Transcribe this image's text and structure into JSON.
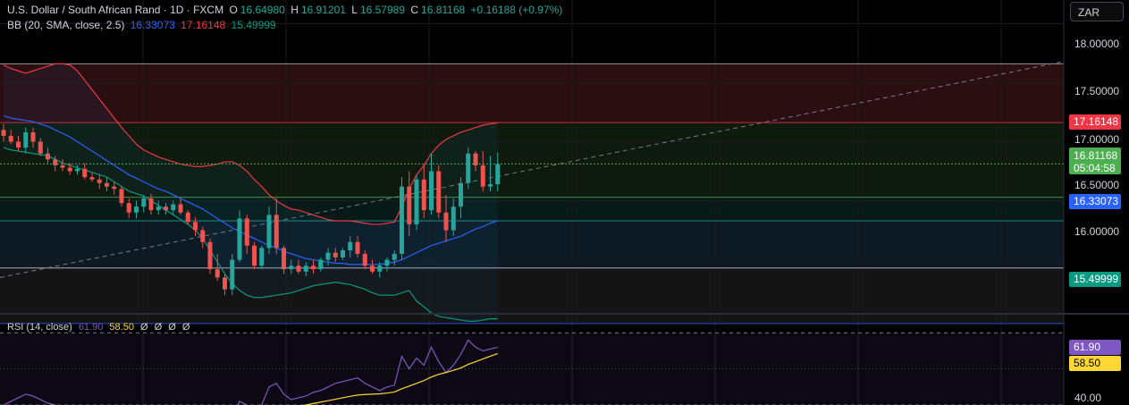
{
  "symbol": {
    "name": "U.S. Dollar / South African Rand · 1D · FXCM",
    "open_label": "O",
    "open": "16.64980",
    "high_label": "H",
    "high": "16.91201",
    "low_label": "L",
    "low": "16.57989",
    "close_label": "C",
    "close": "16.81168",
    "change": "+0.16188 (+0.97%)"
  },
  "bb": {
    "label": "BB (20, SMA, close, 2.5)",
    "basis": "16.33073",
    "upper": "17.16148",
    "lower": "15.49999"
  },
  "rsi": {
    "label": "RSI (14, close)",
    "value": "61.90",
    "ma": "58.50",
    "extra": [
      "Ø",
      "Ø",
      "Ø",
      "Ø"
    ]
  },
  "currency_button": "ZAR",
  "price_axis": {
    "ticks": [
      "18.00000",
      "17.50000",
      "17.00000",
      "16.50000",
      "16.00000"
    ],
    "countdown": "05:04:58"
  },
  "rsi_axis": {
    "ticks": [
      "40.00"
    ]
  },
  "colors": {
    "up": "#26a69a",
    "down": "#ef5350",
    "basis": "#2962ff",
    "upper": "#f23645",
    "lower": "#089981",
    "rsi": "#7e57c2",
    "rsi_ma": "#fdd835",
    "last": "#4caf50"
  },
  "chart_data": {
    "type": "candlestick",
    "last_price": 16.81168,
    "ylim": [
      15.55,
      18.2
    ],
    "candles": [
      [
        17.1,
        17.15,
        17.0,
        17.05
      ],
      [
        17.05,
        17.1,
        16.98,
        17.0
      ],
      [
        17.0,
        17.05,
        16.92,
        16.95
      ],
      [
        16.95,
        17.12,
        16.9,
        17.08
      ],
      [
        17.08,
        17.12,
        16.95,
        17.0
      ],
      [
        17.0,
        17.03,
        16.88,
        16.9
      ],
      [
        16.9,
        16.95,
        16.82,
        16.85
      ],
      [
        16.85,
        16.88,
        16.75,
        16.8
      ],
      [
        16.8,
        16.85,
        16.75,
        16.78
      ],
      [
        16.78,
        16.82,
        16.72,
        16.75
      ],
      [
        16.75,
        16.8,
        16.72,
        16.77
      ],
      [
        16.77,
        16.82,
        16.68,
        16.7
      ],
      [
        16.7,
        16.74,
        16.66,
        16.68
      ],
      [
        16.68,
        16.72,
        16.6,
        16.65
      ],
      [
        16.65,
        16.7,
        16.58,
        16.62
      ],
      [
        16.62,
        16.66,
        16.55,
        16.6
      ],
      [
        16.6,
        16.62,
        16.45,
        16.48
      ],
      [
        16.48,
        16.52,
        16.35,
        16.4
      ],
      [
        16.4,
        16.5,
        16.35,
        16.45
      ],
      [
        16.45,
        16.55,
        16.4,
        16.52
      ],
      [
        16.52,
        16.56,
        16.38,
        16.42
      ],
      [
        16.42,
        16.5,
        16.38,
        16.45
      ],
      [
        16.45,
        16.48,
        16.38,
        16.42
      ],
      [
        16.42,
        16.5,
        16.38,
        16.47
      ],
      [
        16.47,
        16.52,
        16.38,
        16.4
      ],
      [
        16.4,
        16.42,
        16.3,
        16.32
      ],
      [
        16.32,
        16.36,
        16.2,
        16.25
      ],
      [
        16.25,
        16.28,
        16.1,
        16.15
      ],
      [
        16.15,
        16.18,
        15.88,
        15.92
      ],
      [
        15.92,
        16.05,
        15.82,
        15.85
      ],
      [
        15.85,
        15.88,
        15.7,
        15.75
      ],
      [
        15.75,
        16.05,
        15.7,
        16.0
      ],
      [
        16.0,
        16.42,
        15.98,
        16.35
      ],
      [
        16.35,
        16.38,
        16.05,
        16.12
      ],
      [
        16.12,
        16.15,
        15.92,
        15.95
      ],
      [
        15.95,
        16.12,
        15.92,
        16.1
      ],
      [
        16.1,
        16.45,
        16.05,
        16.38
      ],
      [
        16.38,
        16.52,
        16.05,
        16.1
      ],
      [
        16.1,
        16.12,
        15.88,
        15.92
      ],
      [
        15.92,
        16.0,
        15.88,
        15.95
      ],
      [
        15.95,
        16.0,
        15.88,
        15.9
      ],
      [
        15.9,
        15.98,
        15.86,
        15.95
      ],
      [
        15.95,
        16.0,
        15.88,
        15.92
      ],
      [
        15.92,
        16.02,
        15.9,
        16.0
      ],
      [
        16.0,
        16.1,
        15.95,
        16.06
      ],
      [
        16.06,
        16.1,
        15.98,
        16.02
      ],
      [
        16.02,
        16.1,
        16.0,
        16.08
      ],
      [
        16.08,
        16.2,
        16.02,
        16.15
      ],
      [
        16.15,
        16.2,
        16.02,
        16.05
      ],
      [
        16.05,
        16.08,
        15.92,
        15.95
      ],
      [
        15.95,
        16.0,
        15.88,
        15.9
      ],
      [
        15.9,
        15.98,
        15.85,
        15.95
      ],
      [
        15.95,
        16.02,
        15.9,
        16.0
      ],
      [
        16.0,
        16.08,
        15.95,
        16.05
      ],
      [
        16.05,
        16.7,
        16.0,
        16.62
      ],
      [
        16.62,
        16.75,
        16.2,
        16.3
      ],
      [
        16.3,
        16.72,
        16.25,
        16.68
      ],
      [
        16.68,
        16.8,
        16.35,
        16.42
      ],
      [
        16.42,
        16.9,
        16.38,
        16.75
      ],
      [
        16.75,
        16.8,
        16.35,
        16.4
      ],
      [
        16.4,
        16.55,
        16.15,
        16.25
      ],
      [
        16.25,
        16.52,
        16.2,
        16.45
      ],
      [
        16.45,
        16.7,
        16.35,
        16.65
      ],
      [
        16.65,
        16.95,
        16.6,
        16.9
      ],
      [
        16.9,
        16.92,
        16.75,
        16.8
      ],
      [
        16.8,
        16.92,
        16.58,
        16.62
      ],
      [
        16.62,
        16.88,
        16.58,
        16.64
      ],
      [
        16.64,
        16.91,
        16.58,
        16.81
      ]
    ],
    "bb_upper": [
      17.65,
      17.62,
      17.6,
      17.58,
      17.6,
      17.62,
      17.64,
      17.66,
      17.66,
      17.65,
      17.6,
      17.52,
      17.44,
      17.36,
      17.28,
      17.2,
      17.12,
      17.05,
      16.98,
      16.93,
      16.9,
      16.87,
      16.85,
      16.83,
      16.81,
      16.8,
      16.79,
      16.79,
      16.8,
      16.81,
      16.83,
      16.83,
      16.8,
      16.75,
      16.68,
      16.62,
      16.55,
      16.5,
      16.46,
      16.43,
      16.42,
      16.4,
      16.38,
      16.36,
      16.34,
      16.33,
      16.33,
      16.33,
      16.32,
      16.31,
      16.3,
      16.3,
      16.31,
      16.32,
      16.45,
      16.6,
      16.72,
      16.8,
      16.9,
      16.97,
      17.02,
      17.05,
      17.08,
      17.1,
      17.12,
      17.14,
      17.15,
      17.16
    ],
    "bb_basis": [
      17.22,
      17.2,
      17.19,
      17.18,
      17.17,
      17.15,
      17.13,
      17.1,
      17.07,
      17.04,
      17.0,
      16.96,
      16.92,
      16.88,
      16.84,
      16.8,
      16.76,
      16.72,
      16.69,
      16.66,
      16.63,
      16.6,
      16.58,
      16.55,
      16.52,
      16.49,
      16.46,
      16.43,
      16.39,
      16.35,
      16.31,
      16.27,
      16.24,
      16.21,
      16.18,
      16.15,
      16.12,
      16.1,
      16.07,
      16.05,
      16.03,
      16.01,
      16.0,
      15.99,
      15.98,
      15.97,
      15.97,
      15.96,
      15.96,
      15.96,
      15.96,
      15.96,
      15.97,
      15.98,
      16.0,
      16.03,
      16.06,
      16.09,
      16.12,
      16.14,
      16.16,
      16.18,
      16.2,
      16.23,
      16.26,
      16.28,
      16.31,
      16.33
    ],
    "bb_lower": [
      16.95,
      16.93,
      16.92,
      16.91,
      16.9,
      16.89,
      16.88,
      16.85,
      16.82,
      16.8,
      16.78,
      16.76,
      16.74,
      16.72,
      16.7,
      16.66,
      16.62,
      16.58,
      16.56,
      16.54,
      16.5,
      16.46,
      16.42,
      16.38,
      16.34,
      16.3,
      16.25,
      16.18,
      16.08,
      15.98,
      15.88,
      15.8,
      15.74,
      15.7,
      15.68,
      15.68,
      15.69,
      15.7,
      15.71,
      15.72,
      15.74,
      15.76,
      15.78,
      15.79,
      15.8,
      15.81,
      15.8,
      15.79,
      15.77,
      15.75,
      15.72,
      15.7,
      15.7,
      15.7,
      15.72,
      15.74,
      15.65,
      15.6,
      15.55,
      15.52,
      15.51,
      15.5,
      15.49,
      15.48,
      15.48,
      15.49,
      15.5,
      15.5
    ],
    "h_lines": [
      17.66,
      17.16148,
      16.53,
      16.33,
      15.93,
      15.46
    ],
    "trendline": {
      "from": [
        0,
        15.85
      ],
      "to": [
        1190,
        17.68
      ]
    },
    "rsi_values": [
      30,
      32,
      34,
      36,
      35,
      33,
      31,
      30,
      29,
      28,
      28,
      27,
      27,
      26,
      26,
      25,
      25,
      24,
      24,
      25,
      26,
      27,
      26,
      25,
      25,
      26,
      24,
      22,
      20,
      19,
      20,
      24,
      32,
      30,
      27,
      30,
      40,
      42,
      36,
      33,
      34,
      35,
      37,
      38,
      40,
      42,
      43,
      44,
      45,
      42,
      40,
      38,
      40,
      41,
      57,
      50,
      56,
      52,
      62,
      54,
      48,
      52,
      58,
      66,
      62,
      60,
      61,
      61.9
    ],
    "rsi_ma": [
      22,
      24,
      26,
      27,
      27.5,
      27.5,
      27.5,
      27.5,
      27.5,
      27,
      26.5,
      26,
      25.5,
      25,
      24.5,
      24,
      23.5,
      23,
      22.5,
      22.3,
      22.2,
      22.1,
      22,
      22,
      22,
      22,
      21.8,
      21.5,
      21.2,
      21,
      21,
      21.5,
      22.2,
      23,
      23.5,
      24.3,
      25.5,
      27,
      27.8,
      28.5,
      29.2,
      30,
      30.8,
      31.6,
      32.4,
      33.2,
      34,
      34.8,
      35.5,
      35.8,
      36,
      36.2,
      36.6,
      37.2,
      39,
      40.5,
      42,
      43.5,
      45.5,
      47,
      48,
      49.2,
      50.5,
      52.5,
      54,
      55.5,
      57,
      58.5
    ],
    "rsi_ylim": [
      30,
      80
    ]
  }
}
